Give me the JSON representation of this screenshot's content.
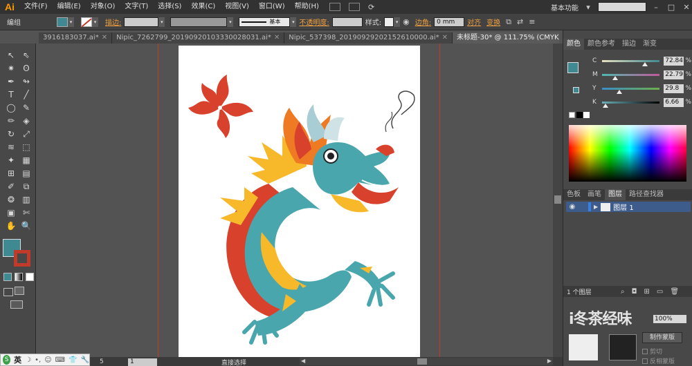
{
  "app": {
    "logo": "Ai"
  },
  "menu": {
    "items": [
      "文件(F)",
      "编辑(E)",
      "对象(O)",
      "文字(T)",
      "选择(S)",
      "效果(C)",
      "视图(V)",
      "窗口(W)",
      "帮助(H)"
    ],
    "workspace": "基本功能",
    "dropdown": "▾",
    "win_controls": [
      "–",
      "□",
      "✕"
    ]
  },
  "control": {
    "label": "编组",
    "stroke_link": "描边:",
    "stroke_style": "基本",
    "opacity_link": "不透明度:",
    "style_label": "样式:",
    "corner_link": "边角:",
    "corner_value": "0 mm",
    "align_link": "对齐",
    "transform_link": "变换"
  },
  "tabs": [
    {
      "label": "3916183037.ai*",
      "close": "✕"
    },
    {
      "label": "Nipic_7262799_20190920103330028031.ai*",
      "close": "✕"
    },
    {
      "label": "Nipic_537398_20190929202152610000.ai*",
      "close": "✕"
    },
    {
      "label": "未标题-30* @ 111.75% (CMYK/预览)",
      "close": "✕"
    }
  ],
  "tools": {
    "icons": [
      "selection-icon",
      "direct-selection-icon",
      "magic-wand-icon",
      "lasso-icon",
      "pen-icon",
      "curvature-icon",
      "type-icon",
      "line-icon",
      "ellipse-icon",
      "paintbrush-icon",
      "pencil-icon",
      "eraser-icon",
      "rotate-icon",
      "scale-icon",
      "warp-icon",
      "free-transform-icon",
      "shape-builder-icon",
      "perspective-icon",
      "mesh-icon",
      "gradient-icon",
      "eyedropper-icon",
      "blend-icon",
      "symbol-sprayer-icon",
      "graph-icon",
      "artboard-icon",
      "slice-icon",
      "hand-icon",
      "zoom-icon"
    ],
    "glyphs": [
      "↖",
      "⇖",
      "✷",
      "ʘ",
      "✒",
      "↬",
      "T",
      "╱",
      "◯",
      "✎",
      "✏",
      "◈",
      "↻",
      "⤢",
      "≋",
      "⬚",
      "✦",
      "▦",
      "⊞",
      "▤",
      "✐",
      "⧉",
      "❂",
      "▥",
      "▣",
      "✄",
      "✋",
      "🔍"
    ],
    "fill_color": "#3f8a92",
    "stroke_color": "#c23b2a"
  },
  "status": {
    "zoom": "1",
    "page": "5",
    "text": "直接选择",
    "prev_arrow": "◀",
    "next_arrow": "▶"
  },
  "ime": {
    "logo": "S",
    "lang": "英",
    "icons": [
      "☽",
      "•,",
      "☺",
      "⌨",
      "👕",
      "🔧"
    ]
  },
  "color_panel": {
    "tabs": [
      "颜色",
      "颜色参考",
      "描边",
      "渐变"
    ],
    "sliders": [
      {
        "letter": "C",
        "value": "72.84",
        "percent": 0.7284,
        "gradient": "linear-gradient(to right,#e8e0c0,#3f8a92)"
      },
      {
        "letter": "M",
        "value": "22.79",
        "percent": 0.2279,
        "gradient": "linear-gradient(to right,#4fb8b0,#c05a9a)"
      },
      {
        "letter": "Y",
        "value": "29.8",
        "percent": 0.298,
        "gradient": "linear-gradient(to right,#3a8ec8,#6cb04a)"
      },
      {
        "letter": "K",
        "value": "6.66",
        "percent": 0.0666,
        "gradient": "linear-gradient(to right,#6ab0b8,#000)"
      }
    ],
    "percent_sign": "%",
    "current_color": "#3f8a92"
  },
  "layers_panel": {
    "tabs": [
      "色板",
      "画笔",
      "图层",
      "路径查找器"
    ],
    "layer_name": "图层 1",
    "count": "1 个图层"
  },
  "transparency_panel": {
    "opacity": "100%",
    "mask_button": "制作蒙版",
    "clip_label": "剪切",
    "invert_label": "反相蒙版",
    "watermark": "i冬茶经味"
  },
  "artwork": {
    "teal": "#4aa6ad",
    "red": "#d8412c",
    "yellow": "#f7b82a",
    "orange": "#ef7a24",
    "dark_red": "#c23b2a"
  }
}
